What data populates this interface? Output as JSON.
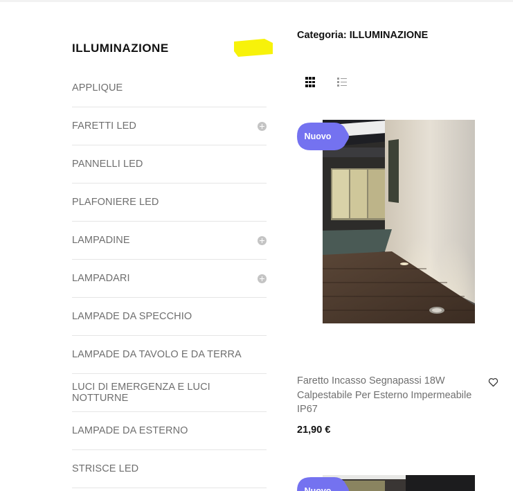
{
  "sidebar": {
    "title": "ILLUMINAZIONE",
    "items": [
      {
        "label": "APPLIQUE",
        "expandable": false
      },
      {
        "label": "FARETTI LED",
        "expandable": true
      },
      {
        "label": "PANNELLI LED",
        "expandable": false
      },
      {
        "label": "PLAFONIERE LED",
        "expandable": false
      },
      {
        "label": "LAMPADINE",
        "expandable": true
      },
      {
        "label": "LAMPADARI",
        "expandable": true
      },
      {
        "label": "LAMPADE DA SPECCHIO",
        "expandable": false
      },
      {
        "label": "LAMPADE DA TAVOLO E DA TERRA",
        "expandable": false
      },
      {
        "label": "LUCI DI EMERGENZA E LUCI NOTTURNE",
        "expandable": false
      },
      {
        "label": "LAMPADE DA ESTERNO",
        "expandable": false
      },
      {
        "label": "STRISCE LED",
        "expandable": false
      }
    ]
  },
  "main": {
    "category_heading": "Categoria: ILLUMINAZIONE",
    "view_modes": [
      "grid-view",
      "list-view"
    ],
    "active_view": "grid-view"
  },
  "products": [
    {
      "badge": "Nuovo",
      "name": "Faretto Incasso Segnapassi 18W Calpestabile Per Esterno Impermeabile IP67",
      "price": "21,90 €"
    },
    {
      "badge": "Nuovo"
    }
  ],
  "colors": {
    "badge": "#7472f0",
    "highlight": "#f7f20a",
    "text_muted": "#6f6f6f",
    "text_dark": "#111111",
    "divider": "#e5e5e5"
  },
  "icons": {
    "expand": "plus-circle-icon",
    "grid": "grid-view-icon",
    "list": "list-view-icon",
    "wishlist": "heart-icon"
  }
}
